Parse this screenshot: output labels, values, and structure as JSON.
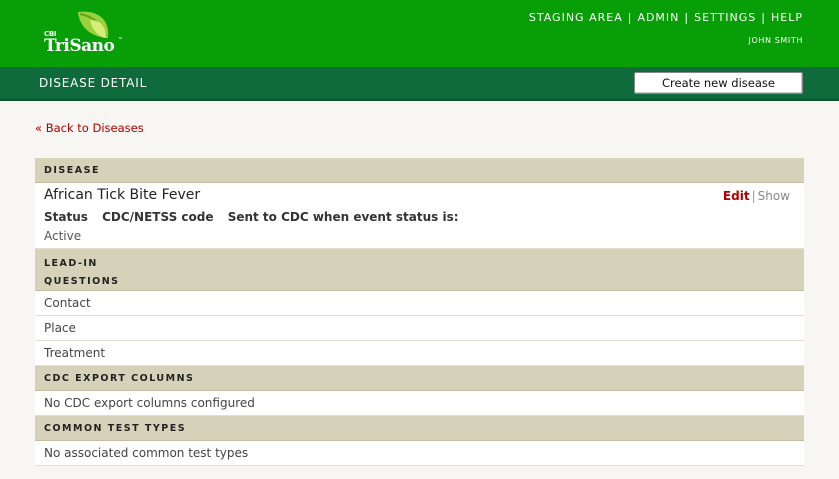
{
  "app": {
    "logo_prefix": "CBI",
    "logo_name": "TriSano",
    "logo_tm": "™"
  },
  "nav": {
    "items": [
      "STAGING AREA",
      "ADMIN",
      "SETTINGS",
      "HELP"
    ],
    "separator": "|",
    "user": "JOHN SMITH"
  },
  "subheader": {
    "title": "DISEASE DETAIL",
    "create_button": "Create new disease"
  },
  "back_link": "« Back to Diseases",
  "disease_section": {
    "heading": "DISEASE",
    "name": "African Tick Bite Fever",
    "columns": [
      "Status",
      "CDC/NETSS code",
      "Sent to CDC when event status is:"
    ],
    "status_value": "Active",
    "edit_label": "Edit",
    "show_label": "Show",
    "action_sep": "|"
  },
  "leadin_section": {
    "heading_line1": "LEAD-IN",
    "heading_line2": "QUESTIONS",
    "items": [
      "Contact",
      "Place",
      "Treatment"
    ]
  },
  "cdc_section": {
    "heading": "CDC EXPORT COLUMNS",
    "message": "No CDC export columns configured"
  },
  "test_section": {
    "heading": "COMMON TEST TYPES",
    "message": "No associated common test types"
  }
}
